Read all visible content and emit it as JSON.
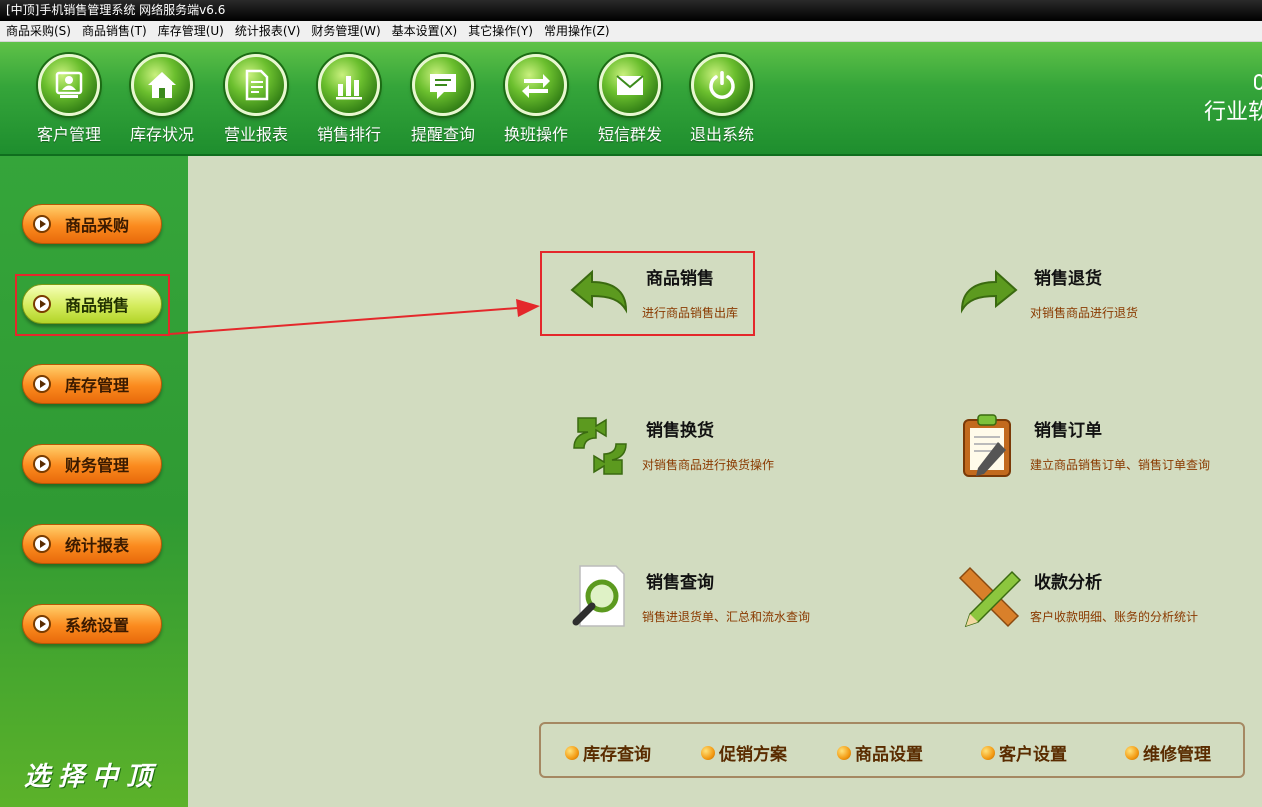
{
  "window": {
    "title": "[中顶]手机销售管理系统 网络服务端v6.6"
  },
  "menu": [
    "商品采购(S)",
    "商品销售(T)",
    "库存管理(U)",
    "统计报表(V)",
    "财务管理(W)",
    "基本设置(X)",
    "其它操作(Y)",
    "常用操作(Z)"
  ],
  "toolbar": {
    "buttons": [
      {
        "label": "客户管理",
        "icon": "customer-icon"
      },
      {
        "label": "库存状况",
        "icon": "home-icon"
      },
      {
        "label": "营业报表",
        "icon": "report-icon"
      },
      {
        "label": "销售排行",
        "icon": "bar-chart-icon"
      },
      {
        "label": "提醒查询",
        "icon": "message-icon"
      },
      {
        "label": "换班操作",
        "icon": "swap-icon"
      },
      {
        "label": "短信群发",
        "icon": "sms-icon"
      },
      {
        "label": "退出系统",
        "icon": "power-icon"
      }
    ],
    "brand": "行业软"
  },
  "sidebar": {
    "items": [
      {
        "label": "商品采购",
        "active": false
      },
      {
        "label": "商品销售",
        "active": true
      },
      {
        "label": "库存管理",
        "active": false
      },
      {
        "label": "财务管理",
        "active": false
      },
      {
        "label": "统计报表",
        "active": false
      },
      {
        "label": "系统设置",
        "active": false
      }
    ],
    "slogan": "选择中顶"
  },
  "functions": [
    {
      "title": "商品销售",
      "desc": "进行商品销售出库",
      "icon": "return-left-arrow-icon"
    },
    {
      "title": "销售退货",
      "desc": "对销售商品进行退货",
      "icon": "return-right-arrow-icon"
    },
    {
      "title": "销售换货",
      "desc": "对销售商品进行换货操作",
      "icon": "exchange-icon"
    },
    {
      "title": "销售订单",
      "desc": "建立商品销售订单、销售订单查询",
      "icon": "clipboard-icon"
    },
    {
      "title": "销售查询",
      "desc": "销售进退货单、汇总和流水查询",
      "icon": "magnifier-icon"
    },
    {
      "title": "收款分析",
      "desc": "客户收款明细、账务的分析统计",
      "icon": "pencil-ruler-icon"
    }
  ],
  "quick_links": [
    "库存查询",
    "促销方案",
    "商品设置",
    "客户设置",
    "维修管理"
  ],
  "colors": {
    "highlight": "#e4282b",
    "toolbar_green": "#35a53a",
    "button_orange": "#fb8a1e",
    "button_active": "#d4ec5d"
  }
}
